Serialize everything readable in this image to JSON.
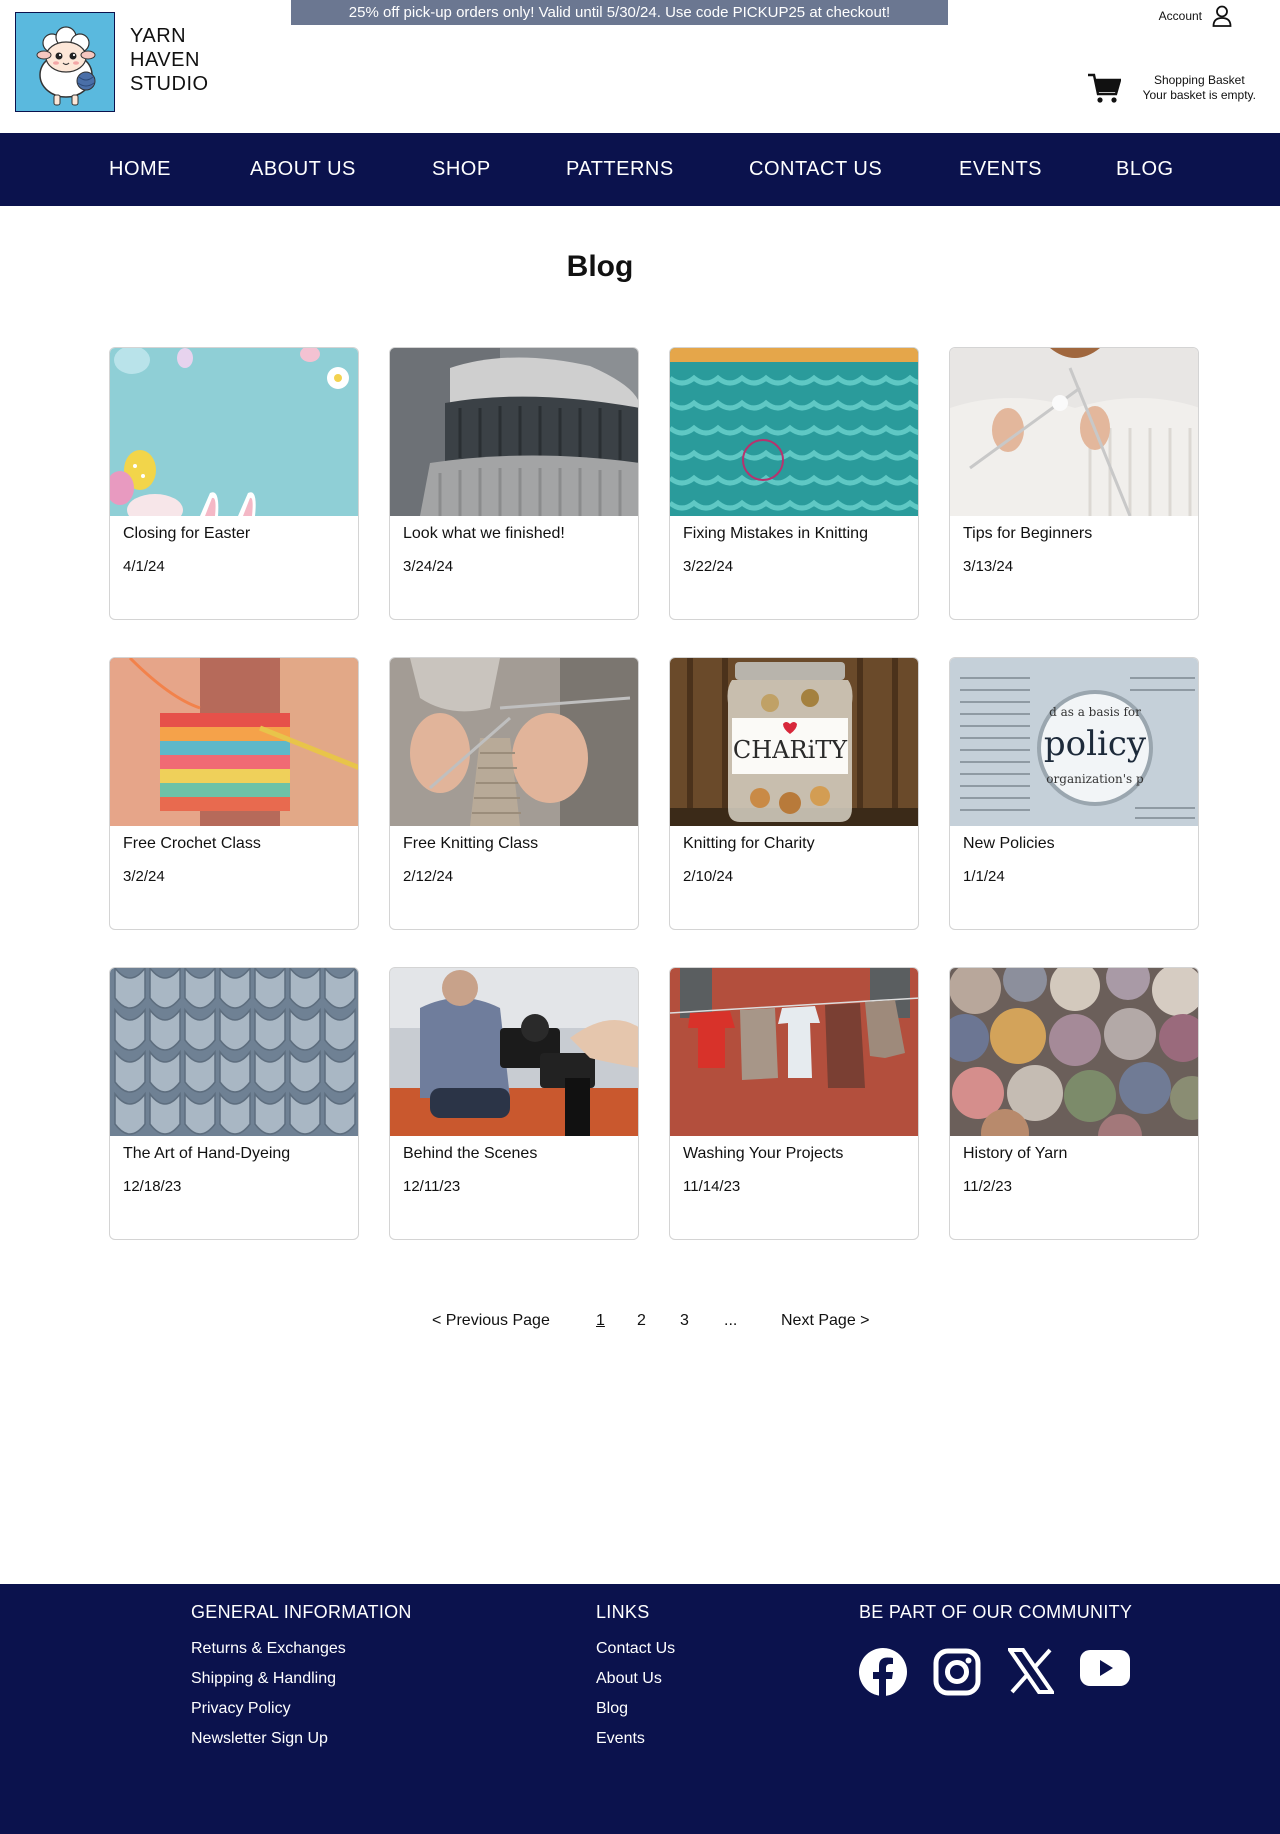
{
  "promo": "25% off pick-up orders only! Valid until 5/30/24. Use code PICKUP25 at checkout!",
  "logo": {
    "line1": "YARN",
    "line2": "HAVEN",
    "line3": "STUDIO",
    "bg": "#5ab9de"
  },
  "account": {
    "label": "Account",
    "icon": "user-icon"
  },
  "basket": {
    "title": "Shopping Basket",
    "status": "Your basket is empty.",
    "icon": "cart-icon"
  },
  "nav": [
    "HOME",
    "ABOUT US",
    "SHOP",
    "PATTERNS",
    "CONTACT US",
    "EVENTS",
    "BLOG"
  ],
  "page_title": "Blog",
  "posts": [
    {
      "title": "Closing for Easter",
      "date": "4/1/24"
    },
    {
      "title": "Look what we finished!",
      "date": "3/24/24"
    },
    {
      "title": "Fixing Mistakes in Knitting",
      "date": "3/22/24"
    },
    {
      "title": "Tips for Beginners",
      "date": "3/13/24"
    },
    {
      "title": "Free Crochet Class",
      "date": "3/2/24"
    },
    {
      "title": "Free Knitting Class",
      "date": "2/12/24"
    },
    {
      "title": "Knitting for Charity",
      "date": "2/10/24"
    },
    {
      "title": "New Policies",
      "date": "1/1/24"
    },
    {
      "title": "The Art of Hand-Dyeing",
      "date": "12/18/23"
    },
    {
      "title": "Behind the Scenes",
      "date": "12/11/23"
    },
    {
      "title": "Washing Your Projects",
      "date": "11/14/23"
    },
    {
      "title": "History of Yarn",
      "date": "11/2/23"
    }
  ],
  "image_text": {
    "charity": "CHARiTY",
    "policy": "policy",
    "policy_top": "d as a basis for",
    "policy_bottom": "organization's p"
  },
  "pagination": {
    "prev": "< Previous Page",
    "pages": [
      "1",
      "2",
      "3"
    ],
    "ellipsis": "...",
    "next": "Next Page >",
    "current": "1"
  },
  "footer": {
    "general": {
      "heading": "GENERAL INFORMATION",
      "links": [
        "Returns & Exchanges",
        "Shipping & Handling",
        "Privacy Policy",
        "Newsletter Sign Up"
      ]
    },
    "links": {
      "heading": "LINKS",
      "links": [
        "Contact Us",
        "About Us",
        "Blog",
        "Events"
      ]
    },
    "community": {
      "heading": "BE PART OF OUR COMMUNITY",
      "icons": [
        "facebook-icon",
        "instagram-icon",
        "x-icon",
        "youtube-icon"
      ]
    }
  },
  "colors": {
    "navy": "#0b124d",
    "promo_bg": "#6b7791"
  }
}
